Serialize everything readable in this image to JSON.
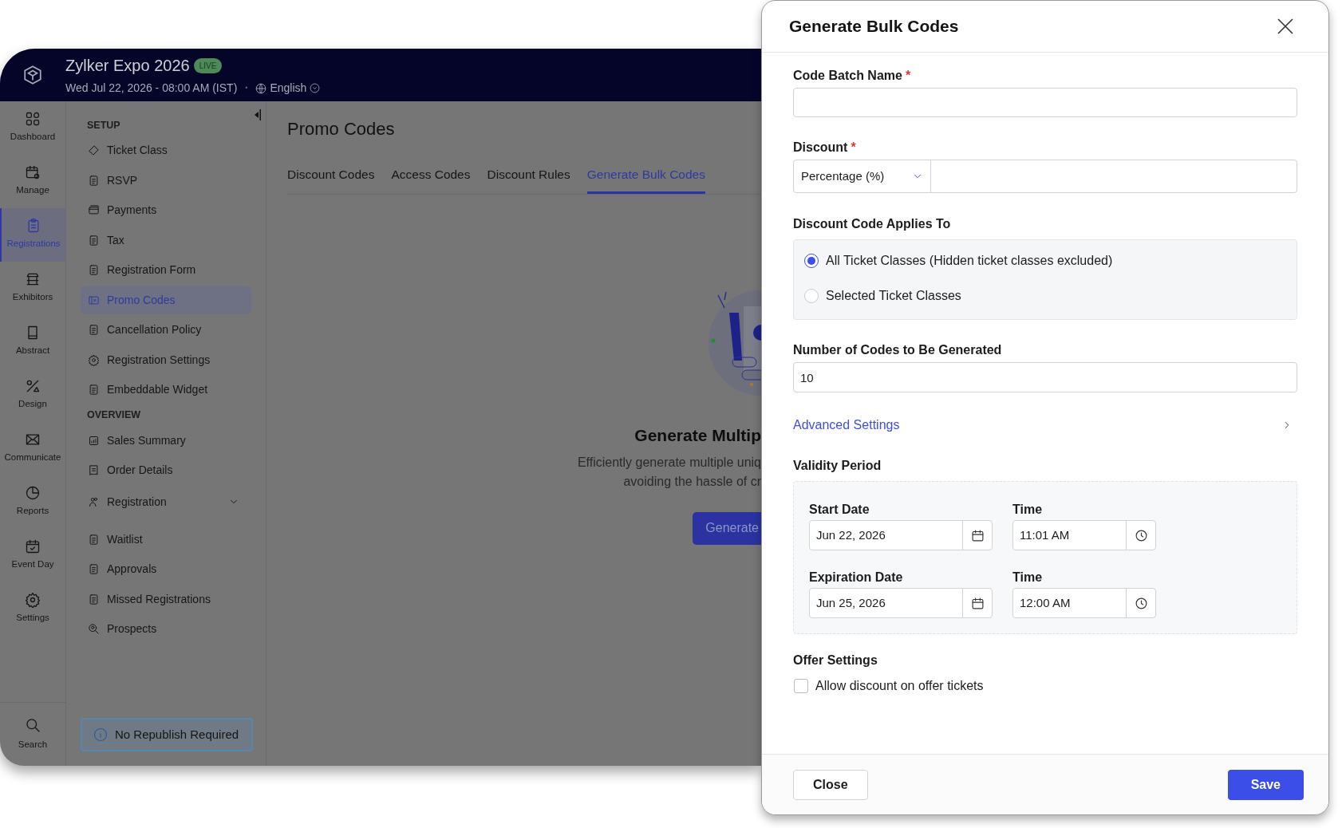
{
  "app": {
    "title": "Zylker Expo 2026",
    "badge": "LIVE",
    "datetime": "Wed Jul 22, 2026 - 08:00 AM (IST)",
    "separator": "•",
    "language": "English"
  },
  "rail": [
    {
      "label": "Dashboard",
      "selected": false
    },
    {
      "label": "Manage",
      "selected": false
    },
    {
      "label": "Registrations",
      "selected": true
    },
    {
      "label": "Exhibitors",
      "selected": false
    },
    {
      "label": "Abstract",
      "selected": false
    },
    {
      "label": "Design",
      "selected": false
    },
    {
      "label": "Communicate",
      "selected": false
    },
    {
      "label": "Reports",
      "selected": false
    },
    {
      "label": "Event Day",
      "selected": false
    },
    {
      "label": "Settings",
      "selected": false
    }
  ],
  "rail_bottom": {
    "label": "Search"
  },
  "subnav": [
    {
      "heading": "SETUP",
      "items": [
        {
          "label": "Ticket Class",
          "kind": "link",
          "selected": false
        },
        {
          "label": "RSVP",
          "kind": "link",
          "selected": false
        },
        {
          "label": "Payments",
          "kind": "link",
          "selected": false
        },
        {
          "label": "Tax",
          "kind": "link",
          "selected": false
        },
        {
          "label": "Registration Form",
          "kind": "link",
          "selected": false
        },
        {
          "label": "Promo Codes",
          "kind": "link",
          "selected": true
        },
        {
          "label": "Cancellation Policy",
          "kind": "link",
          "selected": false
        },
        {
          "label": "Registration Settings",
          "kind": "link",
          "selected": false
        },
        {
          "label": "Embeddable Widget",
          "kind": "link",
          "selected": false
        }
      ]
    },
    {
      "heading": "OVERVIEW",
      "items": [
        {
          "label": "Sales Summary",
          "kind": "link",
          "selected": false
        },
        {
          "label": "Order Details",
          "kind": "link",
          "selected": false
        },
        {
          "label": "Registration",
          "kind": "group",
          "selected": false
        },
        {
          "label": "Waitlist",
          "kind": "link",
          "selected": false
        },
        {
          "label": "Approvals",
          "kind": "link",
          "selected": false
        },
        {
          "label": "Missed Registrations",
          "kind": "link",
          "selected": false
        },
        {
          "label": "Prospects",
          "kind": "link",
          "selected": false
        }
      ]
    }
  ],
  "notice": "No Republish Required",
  "page": {
    "title": "Promo Codes",
    "tabs": [
      {
        "label": "Discount Codes",
        "selected": false
      },
      {
        "label": "Access Codes",
        "selected": false
      },
      {
        "label": "Discount Rules",
        "selected": false
      },
      {
        "label": "Generate Bulk Codes",
        "selected": true
      }
    ],
    "empty_state": {
      "heading": "Generate Multip",
      "lines": [
        "Efficiently generate multiple uniq",
        "avoiding the hassle of cr"
      ],
      "button": "Generate"
    }
  },
  "dialog": {
    "title": "Generate Bulk Codes",
    "batch_name": {
      "label": "Code Batch Name",
      "required_mark": "*"
    },
    "discount": {
      "label": "Discount",
      "required_mark": "*",
      "type_value": "Percentage (%)"
    },
    "applies_to": {
      "label": "Discount Code Applies To",
      "options": [
        {
          "label": "All Ticket Classes (Hidden ticket classes excluded)",
          "selected": true
        },
        {
          "label": "Selected Ticket Classes",
          "selected": false
        }
      ]
    },
    "code_count": {
      "label": "Number of Codes to Be Generated",
      "value": "10"
    },
    "advanced_link": "Advanced Settings",
    "validity": {
      "label": "Validity Period",
      "rows": [
        {
          "date_label": "Start Date",
          "date_value": "Jun 22, 2026",
          "time_label": "Time",
          "time_value": "11:01 AM"
        },
        {
          "date_label": "Expiration Date",
          "date_value": "Jun 25, 2026",
          "time_label": "Time",
          "time_value": "12:00 AM"
        }
      ]
    },
    "offer": {
      "label": "Offer Settings",
      "checkbox": {
        "label": "Allow discount on offer tickets",
        "checked": false
      }
    },
    "buttons": {
      "close": "Close",
      "save": "Save"
    }
  }
}
